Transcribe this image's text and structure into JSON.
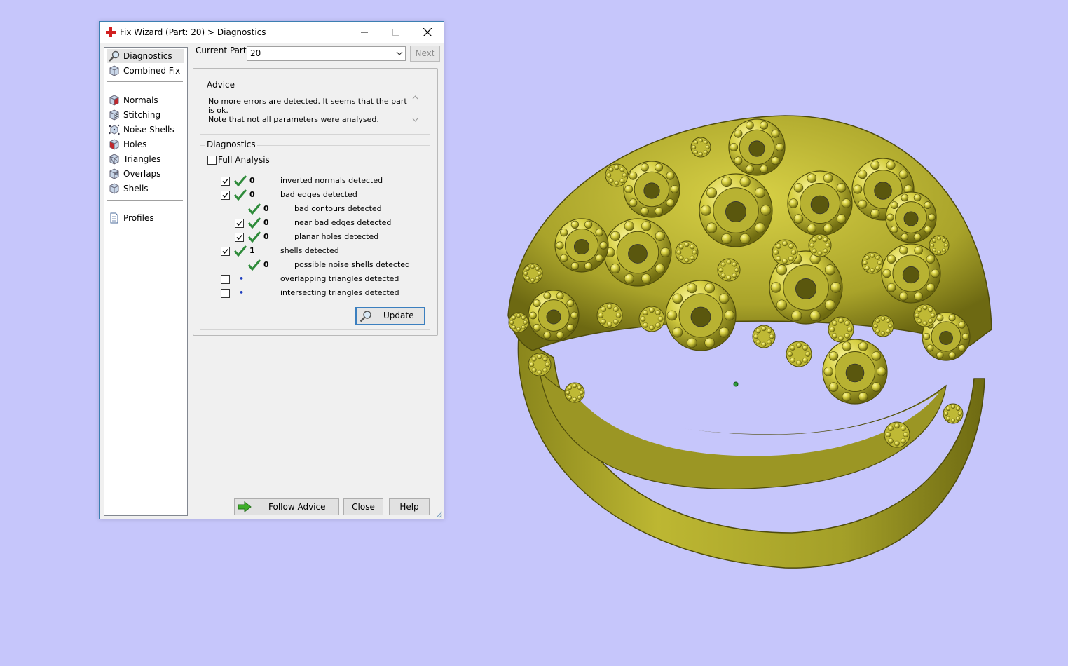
{
  "window": {
    "title": "Fix Wizard (Part: 20) > Diagnostics"
  },
  "nav": {
    "items": [
      {
        "label": "Diagnostics",
        "icon": "magnifier-icon"
      },
      {
        "label": "Combined Fix",
        "icon": "cube-icon"
      },
      {
        "label": "Normals",
        "icon": "normals-cube-icon"
      },
      {
        "label": "Stitching",
        "icon": "stitching-cube-icon"
      },
      {
        "label": "Noise Shells",
        "icon": "noise-shells-icon"
      },
      {
        "label": "Holes",
        "icon": "holes-cube-icon"
      },
      {
        "label": "Triangles",
        "icon": "triangles-cube-icon"
      },
      {
        "label": "Overlaps",
        "icon": "overlaps-cube-icon"
      },
      {
        "label": "Shells",
        "icon": "shells-cube-icon"
      },
      {
        "label": "Profiles",
        "icon": "document-icon"
      }
    ]
  },
  "header": {
    "current_part_label": "Current Part:",
    "current_part_value": "20",
    "next_label": "Next"
  },
  "advice": {
    "legend": "Advice",
    "text_line1": "No more errors are detected. It seems that the part is ok.",
    "text_line2": "Note that not all parameters were analysed."
  },
  "diagnostics": {
    "legend": "Diagnostics",
    "full_analysis_label": "Full Analysis",
    "full_analysis_checked": false,
    "rows": [
      {
        "checkbox": true,
        "checked": true,
        "status": "ok",
        "count": "0",
        "label": "inverted normals detected",
        "indent": 0
      },
      {
        "checkbox": true,
        "checked": true,
        "status": "ok",
        "count": "0",
        "label": "bad edges detected",
        "indent": 0
      },
      {
        "checkbox": false,
        "checked": false,
        "status": "ok",
        "count": "0",
        "label": "bad contours detected",
        "indent": 1
      },
      {
        "checkbox": true,
        "checked": true,
        "status": "ok",
        "count": "0",
        "label": "near bad edges detected",
        "indent": 1
      },
      {
        "checkbox": true,
        "checked": true,
        "status": "ok",
        "count": "0",
        "label": "planar holes detected",
        "indent": 1
      },
      {
        "checkbox": true,
        "checked": true,
        "status": "ok",
        "count": "1",
        "label": "shells detected",
        "indent": 0
      },
      {
        "checkbox": false,
        "checked": false,
        "status": "ok",
        "count": "0",
        "label": "possible noise shells detected",
        "indent": 1
      },
      {
        "checkbox": true,
        "checked": false,
        "status": "dot",
        "count": "",
        "label": "overlapping triangles detected",
        "indent": 0
      },
      {
        "checkbox": true,
        "checked": false,
        "status": "dot",
        "count": "",
        "label": "intersecting triangles detected",
        "indent": 0
      }
    ],
    "update_label": "Update"
  },
  "footer": {
    "follow_advice_label": "Follow Advice",
    "close_label": "Close",
    "help_label": "Help"
  },
  "colors": {
    "background": "#c6c6fb",
    "model": "#c9c43a",
    "check": "#2e8b3a",
    "accent": "#3b7fbf"
  }
}
